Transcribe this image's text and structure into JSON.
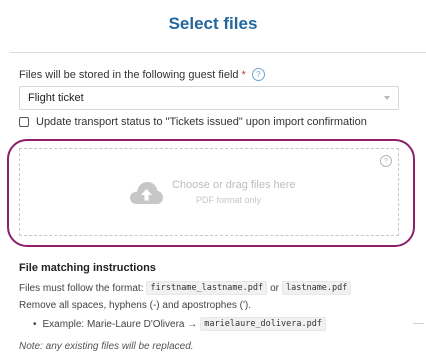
{
  "dialog": {
    "title": "Select files"
  },
  "guest_field": {
    "label": "Files will be stored in the following guest field",
    "required_mark": "*",
    "selected_value": "Flight ticket"
  },
  "checkbox": {
    "label": "Update transport status to \"Tickets issued\" upon import confirmation",
    "checked": false
  },
  "dropzone": {
    "main_text": "Choose or drag files here",
    "sub_text": "PDF format only",
    "highlight_color": "#8e1f6a"
  },
  "instructions": {
    "title": "File matching instructions",
    "format_prefix": "Files must follow the format:",
    "format_code_1": "firstname_lastname.pdf",
    "format_or": "or",
    "format_code_2": "lastname.pdf",
    "remove_line": "Remove all spaces, hyphens (-) and apostrophes (').",
    "example_prefix": "Example: Marie-Laure D'Olivera →",
    "example_code": "marielaure_dolivera.pdf",
    "note": "Note: any existing files will be replaced."
  },
  "colors": {
    "title": "#24679e",
    "accent": "#8e1f6a"
  }
}
